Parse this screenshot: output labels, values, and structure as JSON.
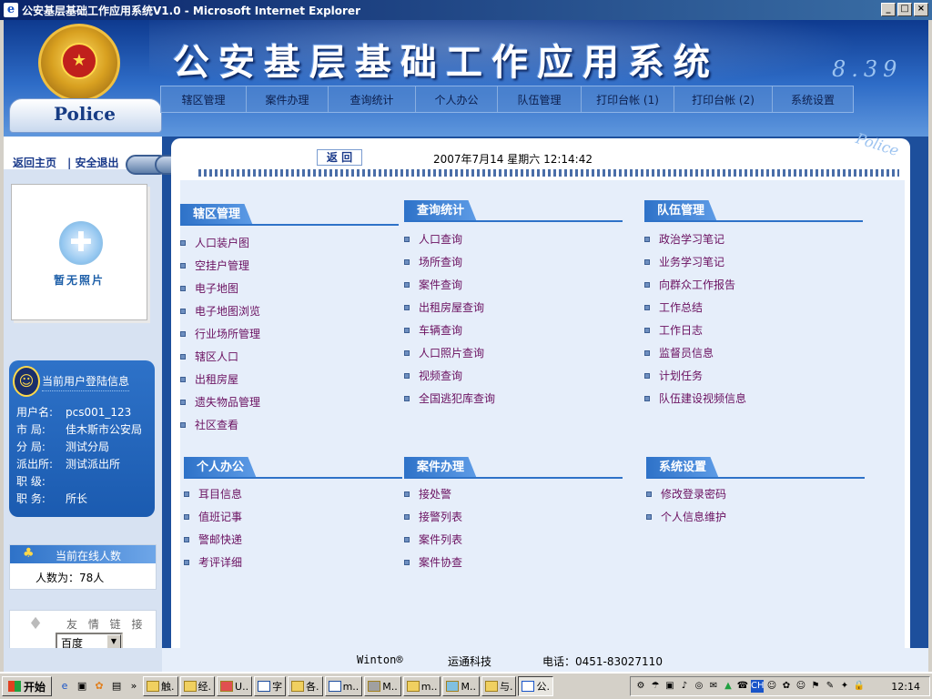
{
  "window": {
    "title": "公安基层基础工作应用系统V1.0 - Microsoft Internet Explorer",
    "btn_min": "_",
    "btn_max": "□",
    "btn_close": "×"
  },
  "header": {
    "title": "公安基层基础工作应用系统",
    "date_deco": "8.39",
    "badge_text": "Police",
    "nav": [
      "辖区管理",
      "案件办理",
      "查询统计",
      "个人办公",
      "队伍管理",
      "打印台帐 (1)",
      "打印台帐 (2)",
      "系统设置"
    ]
  },
  "sidebar": {
    "home_link": "返回主页",
    "logout_link": "| 安全退出",
    "photo_placeholder": "暂无照片",
    "user_info": {
      "title": "当前用户登陆信息",
      "rows": [
        {
          "k": "用户名:",
          "v": "pcs001_123"
        },
        {
          "k": "市  局:",
          "v": "佳木斯市公安局"
        },
        {
          "k": "分  局:",
          "v": "测试分局"
        },
        {
          "k": "派出所:",
          "v": "测试派出所"
        },
        {
          "k": "职  级:",
          "v": ""
        },
        {
          "k": "职  务:",
          "v": "所长"
        }
      ]
    },
    "online": {
      "title": "当前在线人数",
      "count": "人数为：78人"
    },
    "friends": {
      "title": "友 情 链 接",
      "selected": "百度"
    }
  },
  "main": {
    "back_button": "返 回",
    "datetime": "2007年7月14  星期六 12:14:42",
    "corner_text": "Police",
    "sections": [
      {
        "title": "辖区管理",
        "items": [
          "人口装户图",
          "空挂户管理",
          "电子地图",
          "电子地图浏览",
          "行业场所管理",
          "辖区人口",
          "出租房屋",
          "遗失物品管理",
          "社区查看"
        ]
      },
      {
        "title": "查询统计",
        "items": [
          "人口查询",
          "场所查询",
          "案件查询",
          "出租房屋查询",
          "车辆查询",
          "人口照片查询",
          "视频查询",
          "全国逃犯库查询"
        ]
      },
      {
        "title": "队伍管理",
        "items": [
          "政治学习笔记",
          "业务学习笔记",
          "向群众工作报告",
          "工作总结",
          "工作日志",
          "监督员信息",
          "计划任务",
          "队伍建设视频信息"
        ]
      },
      {
        "title": "个人办公",
        "items": [
          "耳目信息",
          "值班记事",
          "警邮快递",
          "考评详细"
        ]
      },
      {
        "title": "案件办理",
        "items": [
          "接处警",
          "接警列表",
          "案件列表",
          "案件协查"
        ]
      },
      {
        "title": "系统设置",
        "items": [
          "修改登录密码",
          "个人信息维护"
        ]
      }
    ]
  },
  "footer": {
    "brand": "Winton®",
    "company": "运通科技",
    "phone": "电话：0451-83027110"
  },
  "taskbar": {
    "start": "开始",
    "tasks": [
      "触.",
      "经.",
      "U..",
      "字",
      "各.",
      "m..",
      "M..",
      "m..",
      "M..",
      "与.",
      "公."
    ],
    "clock": "12:14"
  },
  "colors": {
    "header_blue": "#2e6cc7",
    "section_blue": "#2e72c8",
    "link_purple": "#6a1060"
  }
}
